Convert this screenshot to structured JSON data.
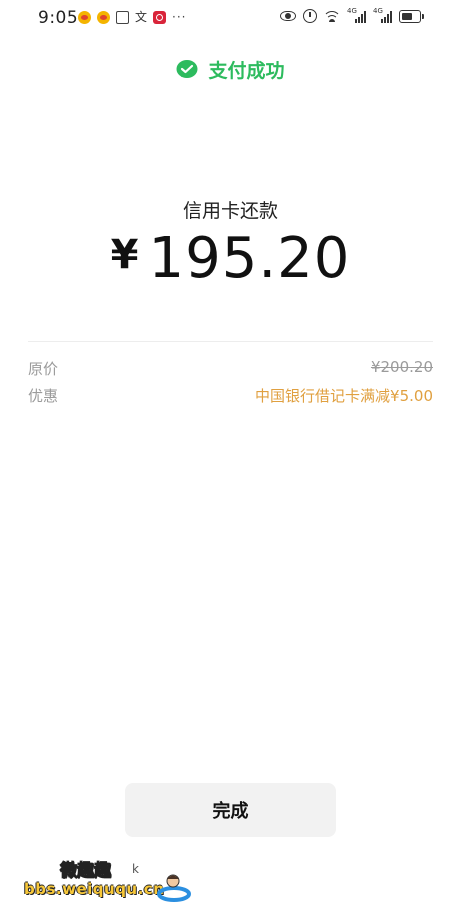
{
  "status_bar": {
    "time": "9:05",
    "more": "···",
    "notification_icons": [
      "weibo-icon",
      "weibo-icon",
      "photo-icon",
      "text-icon",
      "red-app-icon"
    ],
    "text_icon_char": "文",
    "network_tag_1": "4G",
    "network_tag_2": "4G"
  },
  "header": {
    "success_text": "支付成功",
    "accent_color": "#2dbb5e"
  },
  "payment": {
    "purpose": "信用卡还款",
    "currency_symbol": "¥",
    "amount": "195.20"
  },
  "details": {
    "original_label": "原价",
    "original_value": "¥200.20",
    "discount_label": "优惠",
    "discount_value": "中国银行借记卡满减¥5.00",
    "discount_color": "#e0a040"
  },
  "actions": {
    "done_label": "完成"
  },
  "watermark": {
    "chinese": "微趣趣",
    "url": "bbs.weiququ.cn",
    "mark": "k"
  }
}
